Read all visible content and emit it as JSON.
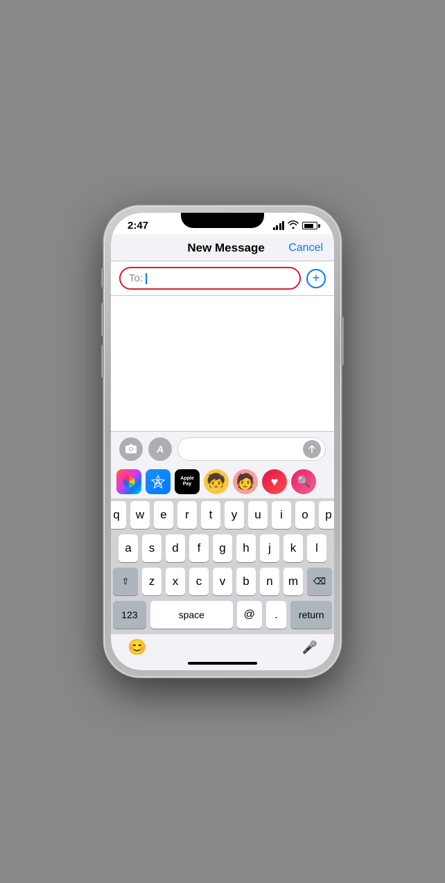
{
  "status_bar": {
    "time": "2:47",
    "battery_level": "80"
  },
  "nav": {
    "title": "New Message",
    "cancel_label": "Cancel"
  },
  "to_field": {
    "label": "To:",
    "placeholder": ""
  },
  "toolbar": {
    "send_placeholder": ""
  },
  "keyboard": {
    "row1": [
      "q",
      "w",
      "e",
      "r",
      "t",
      "y",
      "u",
      "i",
      "o",
      "p"
    ],
    "row2": [
      "a",
      "s",
      "d",
      "f",
      "g",
      "h",
      "j",
      "k",
      "l"
    ],
    "row3": [
      "z",
      "x",
      "c",
      "v",
      "b",
      "n",
      "m"
    ],
    "special": {
      "shift": "⇧",
      "delete": "⌫",
      "numbers": "123",
      "space": "space",
      "at": "@",
      "dot": ".",
      "return": "return"
    }
  },
  "apps": [
    {
      "name": "Photos",
      "type": "photos"
    },
    {
      "name": "App Store",
      "type": "appstore",
      "label": "A"
    },
    {
      "name": "Apple Pay",
      "type": "applepay",
      "label": "Apple Pay"
    },
    {
      "name": "Memoji 1",
      "type": "memoji1",
      "emoji": "🧒"
    },
    {
      "name": "Memoji 2",
      "type": "memoji2",
      "emoji": "🧑"
    },
    {
      "name": "Heart app",
      "type": "red",
      "symbol": "♥"
    },
    {
      "name": "Globe app",
      "type": "globe",
      "symbol": "🔍"
    }
  ],
  "bottom": {
    "emoji_icon": "😊",
    "mic_icon": "🎤"
  }
}
